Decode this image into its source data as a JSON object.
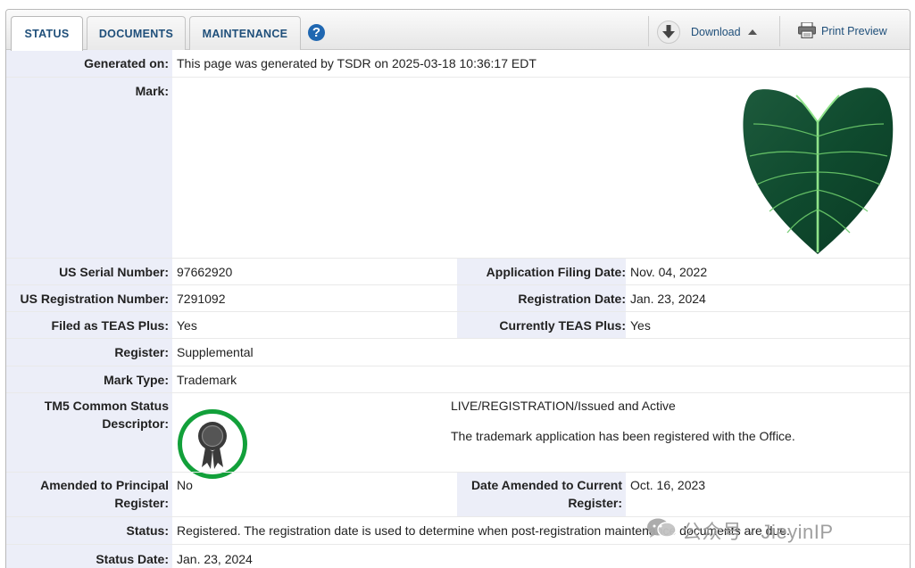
{
  "tabs": [
    {
      "label": "STATUS",
      "active": true
    },
    {
      "label": "DOCUMENTS",
      "active": false
    },
    {
      "label": "MAINTENANCE",
      "active": false
    }
  ],
  "toolbar": {
    "help_icon": "question-circle-icon",
    "download_label": "Download",
    "print_label": "Print Preview"
  },
  "colors": {
    "label_bg": "#eceef8",
    "link": "#1f4f7a",
    "seal_ring": "#12a03a"
  },
  "record": {
    "generated_on": {
      "label": "Generated on:",
      "value": "This page was generated by TSDR on 2025-03-18 10:36:17 EDT"
    },
    "mark": {
      "label": "Mark:"
    },
    "serial": {
      "label": "US Serial Number:",
      "value": "97662920"
    },
    "filing_date": {
      "label": "Application Filing Date:",
      "value": "Nov. 04, 2022"
    },
    "reg_number": {
      "label": "US Registration Number:",
      "value": "7291092"
    },
    "reg_date": {
      "label": "Registration Date:",
      "value": "Jan. 23, 2024"
    },
    "teas_filed": {
      "label": "Filed as TEAS Plus:",
      "value": "Yes"
    },
    "teas_current": {
      "label": "Currently TEAS Plus:",
      "value": "Yes"
    },
    "register": {
      "label": "Register:",
      "value": "Supplemental"
    },
    "mark_type": {
      "label": "Mark Type:",
      "value": "Trademark"
    },
    "tm5": {
      "label_line1": "TM5 Common Status",
      "label_line2": "Descriptor:",
      "value_line1": "LIVE/REGISTRATION/Issued and Active",
      "value_line2": "The trademark application has been registered with the Office."
    },
    "amended_principal": {
      "label_line1": "Amended to Principal",
      "label_line2": "Register:",
      "value": "No"
    },
    "amended_current": {
      "label_line1": "Date Amended to Current",
      "label_line2": "Register:",
      "value": "Oct. 16, 2023"
    },
    "status": {
      "label": "Status:",
      "value": "Registered. The registration date is used to determine when post-registration maintenance documents are due."
    },
    "status_date": {
      "label": "Status Date:",
      "value": "Jan. 23, 2024"
    }
  },
  "watermark": {
    "text": "公众号 · JieyinIP"
  }
}
